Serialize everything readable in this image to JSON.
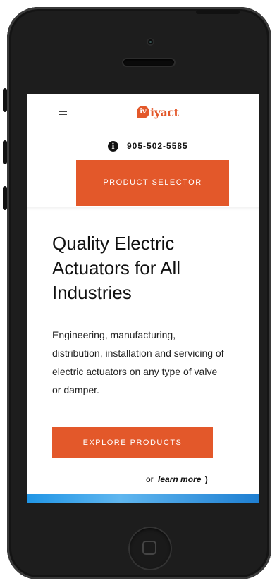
{
  "header": {
    "logo_text": "iyact",
    "logo_mark": "iv",
    "menu_icon": "hamburger-menu-icon",
    "info_icon": "info-icon",
    "phone": "905-502-5585",
    "product_selector_label": "PRODUCT SELECTOR"
  },
  "hero": {
    "title": "Quality Electric Actuators for All Industries",
    "description": "Engineering, manufacturing, distribution, installation and servicing of electric actuators on any type of valve or damper.",
    "explore_label": "EXPLORE PRODUCTS",
    "or_text": "or",
    "learn_more_label": "learn more",
    "learn_more_chevron": ")"
  },
  "colors": {
    "accent": "#e3582a",
    "text": "#111111",
    "band": "#2196e6"
  }
}
